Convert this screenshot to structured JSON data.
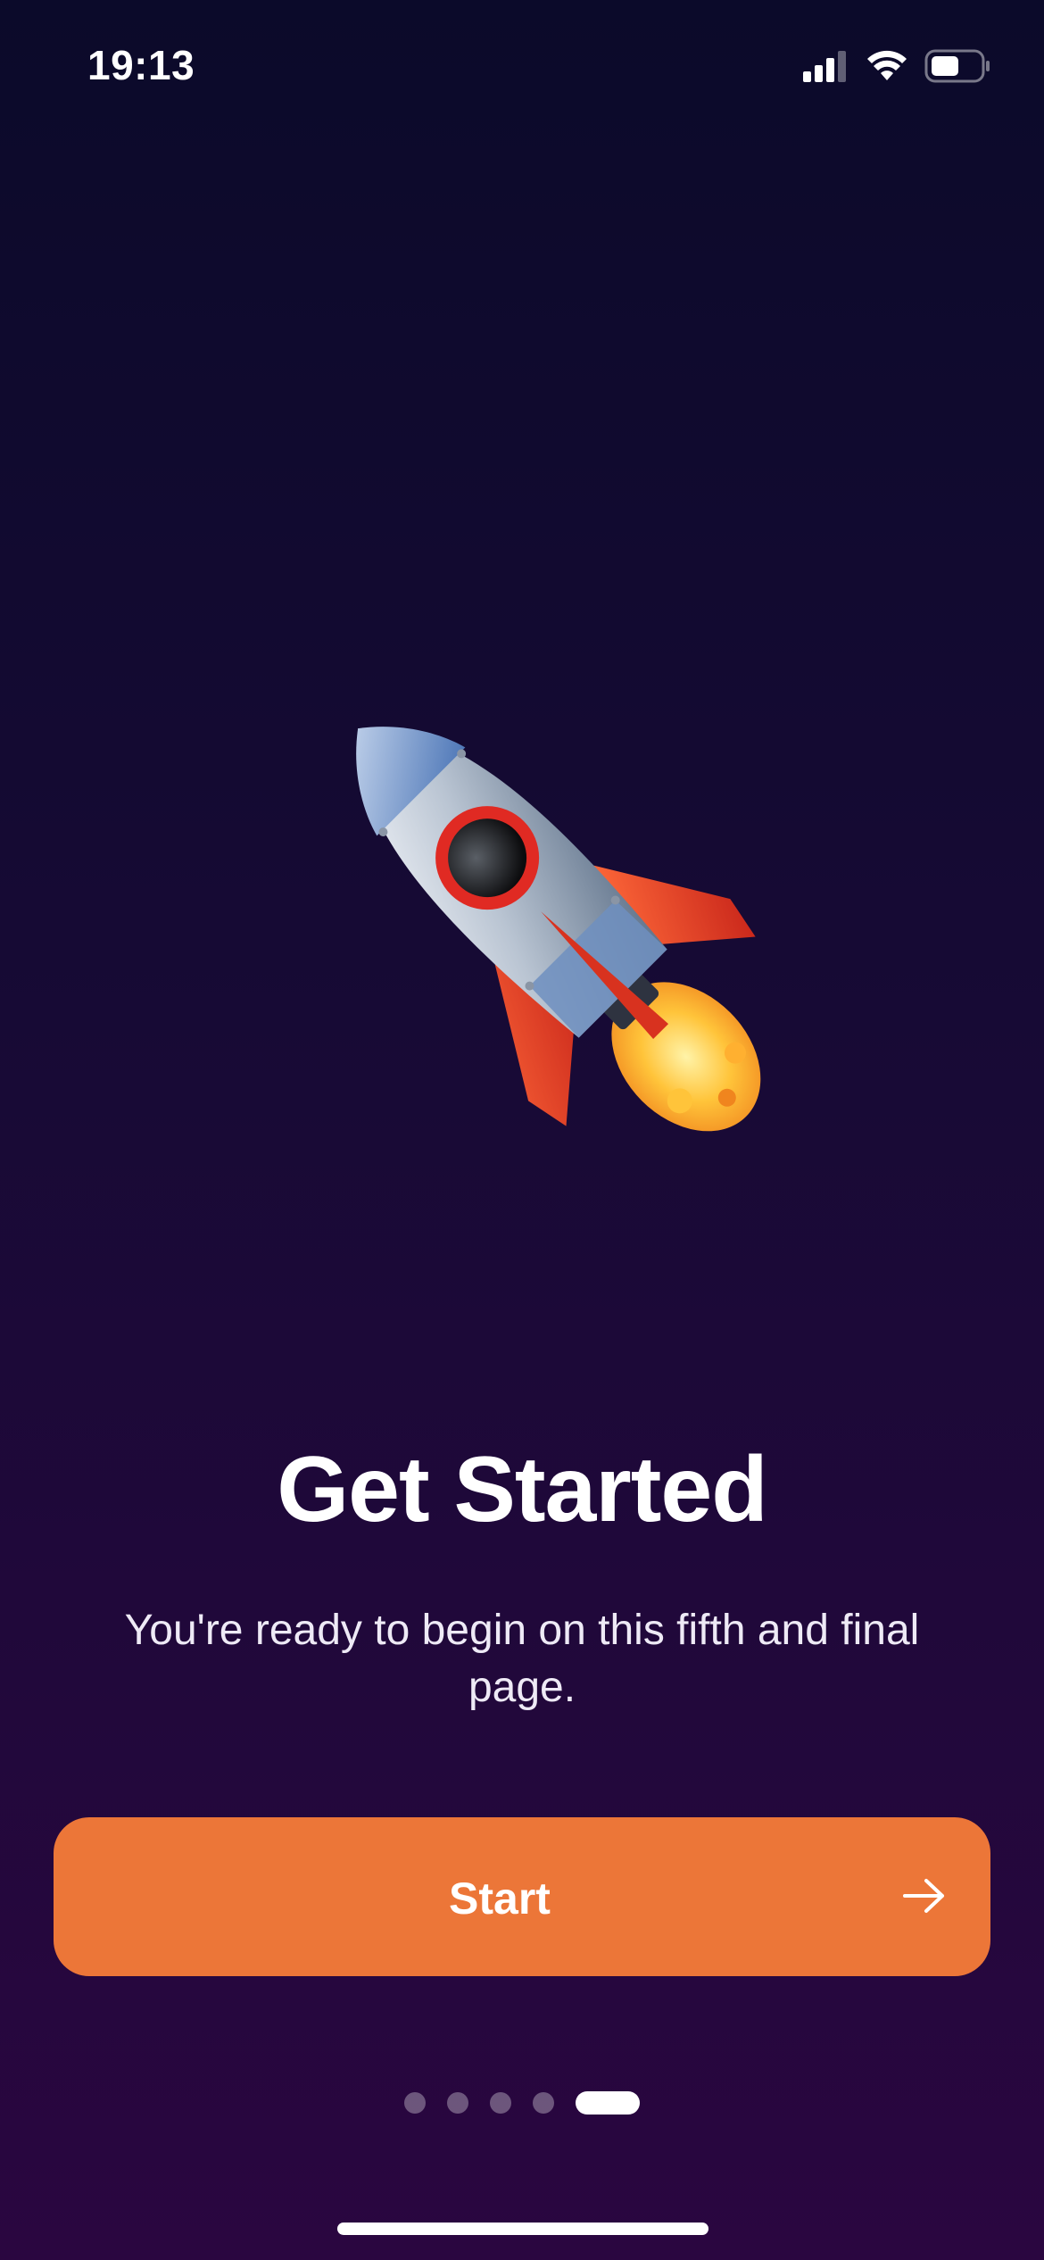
{
  "status_bar": {
    "time": "19:13",
    "icons": [
      "cellular-signal-icon",
      "wifi-icon",
      "battery-icon"
    ]
  },
  "hero": {
    "icon": "rocket-icon"
  },
  "onboarding": {
    "title": "Get Started",
    "subtitle": "You're ready to begin on this fifth and final page.",
    "start_label": "Start",
    "start_icon": "arrow-right-icon",
    "page_count": 5,
    "current_page": 5
  },
  "colors": {
    "background_top": "#0b0a2a",
    "background_bottom": "#2a0640",
    "accent": "#ec7638",
    "text": "#ffffff"
  }
}
